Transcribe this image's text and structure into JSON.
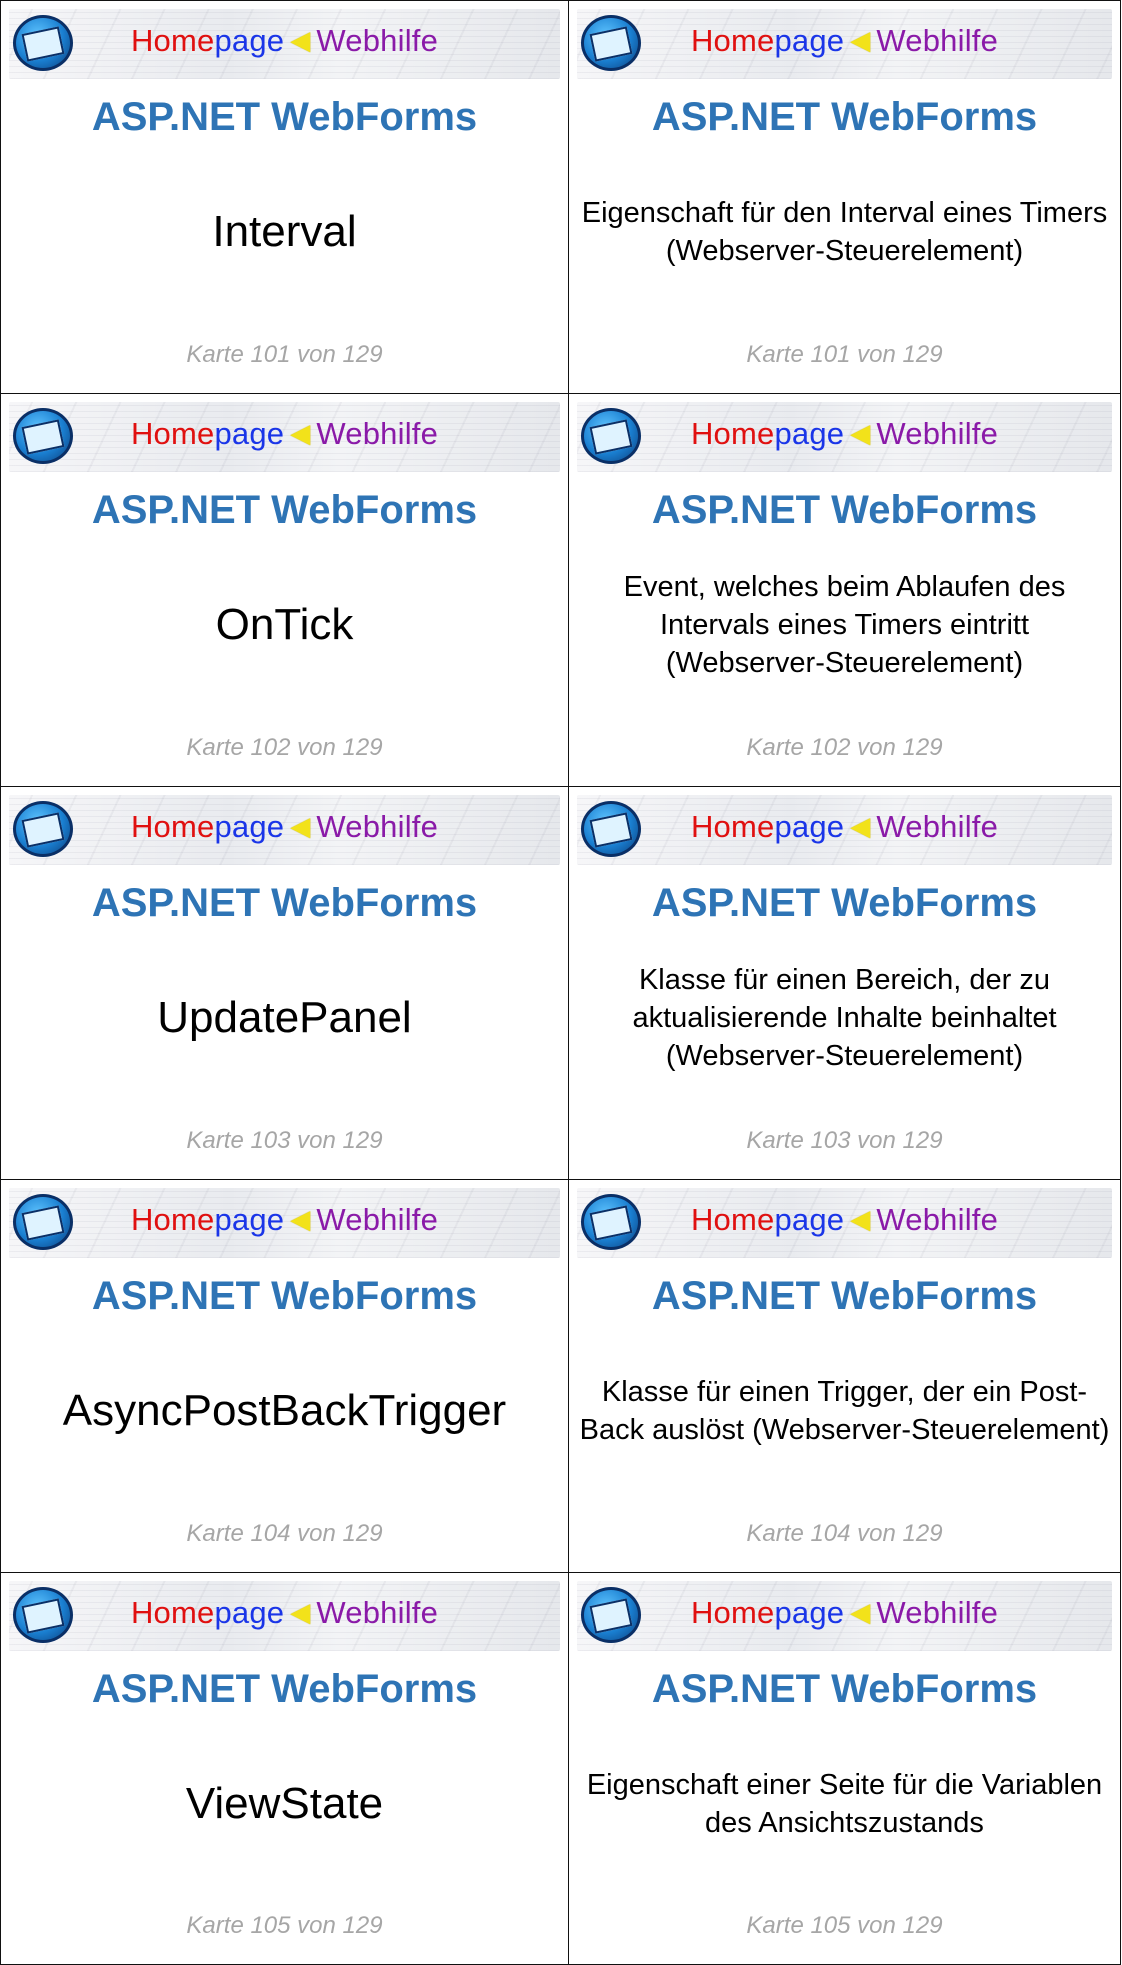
{
  "banner": {
    "home": "Home",
    "page": "page",
    "arrow": "◀",
    "web": "Webhilfe"
  },
  "title": "ASP.NET WebForms",
  "cards": [
    {
      "term": "Interval",
      "description": "Eigenschaft für den Interval eines Timers (Webserver-Steuerelement)",
      "footer": "Karte 101 von 129"
    },
    {
      "term": "OnTick",
      "description": "Event, welches beim Ablaufen des Intervals eines Timers eintritt (Webserver-Steuerelement)",
      "footer": "Karte 102 von 129"
    },
    {
      "term": "UpdatePanel",
      "description": "Klasse für einen Bereich, der zu aktualisierende Inhalte beinhaltet (Webserver-Steuerelement)",
      "footer": "Karte 103 von 129"
    },
    {
      "term": "AsyncPostBackTrigger",
      "description": "Klasse für einen Trigger, der ein Post-Back auslöst (Webserver-Steuerelement)",
      "footer": "Karte 104 von 129"
    },
    {
      "term": "ViewState",
      "description": "Eigenschaft einer Seite für die Variablen des Ansichtszustands",
      "footer": "Karte 105 von 129"
    }
  ]
}
